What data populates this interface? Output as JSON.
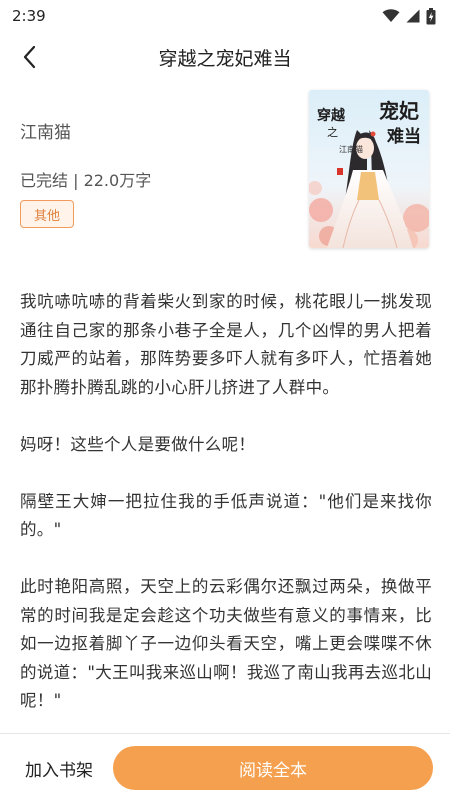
{
  "status_bar": {
    "time": "2:39"
  },
  "nav": {
    "title": "穿越之宠妃难当"
  },
  "book": {
    "author": "江南猫",
    "status_text": "已完结 | 22.0万字",
    "tag": "其他",
    "cover": {
      "title_text": "穿越之宠妃难当",
      "author_text": "江南猫",
      "accent_color": "#f5a04f"
    }
  },
  "content": {
    "paragraphs": [
      "我吭哧吭哧的背着柴火到家的时候，桃花眼儿一挑发现通往自己家的那条小巷子全是人，几个凶悍的男人把着刀威严的站着，那阵势要多吓人就有多吓人，忙捂着她那扑腾扑腾乱跳的小心肝儿挤进了人群中。",
      "妈呀！这些个人是要做什么呢！",
      "隔壁王大婶一把拉住我的手低声说道：\"他们是来找你的。\"",
      "此时艳阳高照，天空上的云彩偶尔还飘过两朵，换做平常的时间我是定会趁这个功夫做些有意义的事情来，比如一边抠着脚丫子一边仰头看天空，嘴上更会喋喋不休的说道：\"大王叫我来巡山啊！我巡了南山我再去巡北山呢！\""
    ]
  },
  "bottom_bar": {
    "add_shelf_label": "加入书架",
    "read_label": "阅读全本",
    "accent_color": "#f5a04f"
  }
}
